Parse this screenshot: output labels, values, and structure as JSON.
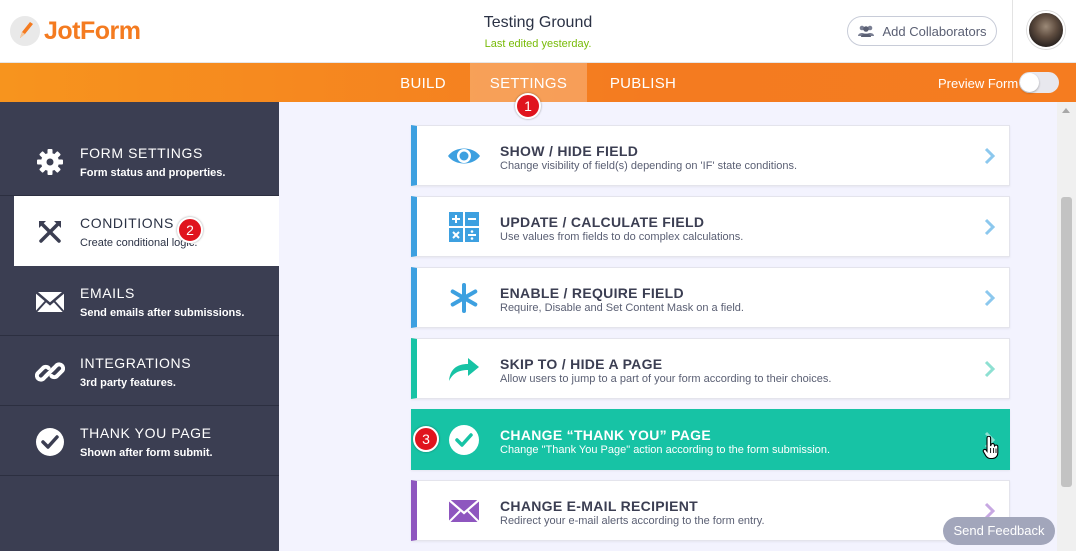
{
  "header": {
    "logo_text": "JotForm",
    "form_title": "Testing Ground",
    "form_subtitle": "Last edited yesterday.",
    "collab_label": "Add Collaborators"
  },
  "nav": {
    "tabs": [
      {
        "label": "BUILD"
      },
      {
        "label": "SETTINGS"
      },
      {
        "label": "PUBLISH"
      }
    ],
    "preview_label": "Preview Form",
    "preview_enabled": false
  },
  "sidebar": {
    "items": [
      {
        "title": "FORM SETTINGS",
        "desc": "Form status and properties.",
        "icon": "gear-icon"
      },
      {
        "title": "CONDITIONS",
        "desc": "Create conditional logic.",
        "icon": "conditions-icon"
      },
      {
        "title": "EMAILS",
        "desc": "Send emails after submissions.",
        "icon": "envelope-icon"
      },
      {
        "title": "INTEGRATIONS",
        "desc": "3rd party features.",
        "icon": "link-icon"
      },
      {
        "title": "THANK YOU PAGE",
        "desc": "Shown after form submit.",
        "icon": "check-circle-icon"
      }
    ]
  },
  "conditions": [
    {
      "title": "SHOW / HIDE FIELD",
      "desc": "Change visibility of field(s) depending on 'IF' state conditions.",
      "icon": "eye-icon"
    },
    {
      "title": "UPDATE / CALCULATE FIELD",
      "desc": "Use values from fields to do complex calculations.",
      "icon": "calculator-icon"
    },
    {
      "title": "ENABLE / REQUIRE FIELD",
      "desc": "Require, Disable and Set Content Mask on a field.",
      "icon": "asterisk-icon"
    },
    {
      "title": "SKIP TO / HIDE A PAGE",
      "desc": "Allow users to jump to a part of your form according to their choices.",
      "icon": "share-arrow-icon"
    },
    {
      "title": "CHANGE “THANK YOU” PAGE",
      "desc": "Change \"Thank You Page\" action according to the form submission.",
      "icon": "check-circle-icon"
    },
    {
      "title": "CHANGE E-MAIL RECIPIENT",
      "desc": "Redirect your e-mail alerts according to the form entry.",
      "icon": "envelope-icon"
    }
  ],
  "markers": [
    "1",
    "2",
    "3"
  ],
  "feedback_label": "Send Feedback",
  "colors": {
    "brand_orange": "#f47b20",
    "sidebar_bg": "#3b3e52",
    "blue_accent": "#3da0e0",
    "teal_accent": "#17c3a5",
    "purple_accent": "#8e56bf",
    "marker_red": "#e0141e"
  }
}
